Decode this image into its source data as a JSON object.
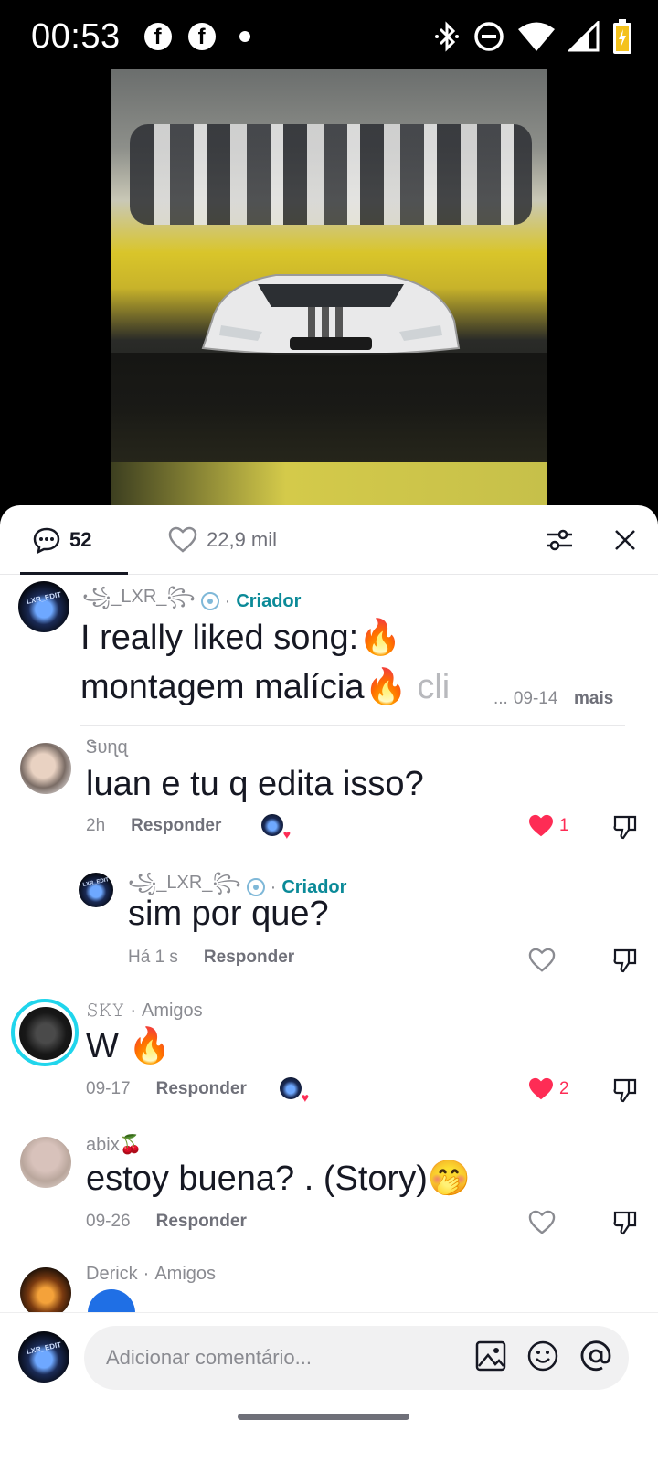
{
  "status_bar": {
    "time": "00:53",
    "left_icons": [
      "facebook-icon",
      "facebook-icon",
      "notification-dot"
    ],
    "right_icons": [
      "bluetooth-icon",
      "do-not-disturb-icon",
      "wifi-icon",
      "signal-icon",
      "battery-charging-icon"
    ]
  },
  "video": {
    "description_icon": "video-preview"
  },
  "header": {
    "comment_count": "52",
    "like_count": "22,9 mil"
  },
  "comments": [
    {
      "username": "꧁_LXR_꧂",
      "tag": "Criador",
      "text_line1": "I really liked  song:🔥",
      "text_line2_main": "montagem malícia🔥 ",
      "text_line2_fade": "cli",
      "ellipsis": "...",
      "date": "09-14",
      "more": "mais"
    },
    {
      "username": "Ꮥυɳɋ",
      "text": "luan e tu q edita isso?",
      "time": "2h",
      "reply": "Responder",
      "likes": "1"
    },
    {
      "username": "꧁_LXR_꧂",
      "tag": "Criador",
      "text": "sim por que?",
      "time": "Há 1 s",
      "reply": "Responder"
    },
    {
      "username": "𝚂𝙺𝚈",
      "tag": "Amigos",
      "text": "W 🔥",
      "time": "09-17",
      "reply": "Responder",
      "likes": "2"
    },
    {
      "username": "abix🍒",
      "text": "estoy buena? . (Story)🤭",
      "time": "09-26",
      "reply": "Responder"
    },
    {
      "username": "Derick",
      "tag": "Amigos"
    }
  ],
  "composer": {
    "placeholder": "Adicionar comentário..."
  },
  "colors": {
    "accent_red": "#fe2c55",
    "creator_teal": "#0b8a98",
    "sky_ring": "#20d5ec"
  }
}
